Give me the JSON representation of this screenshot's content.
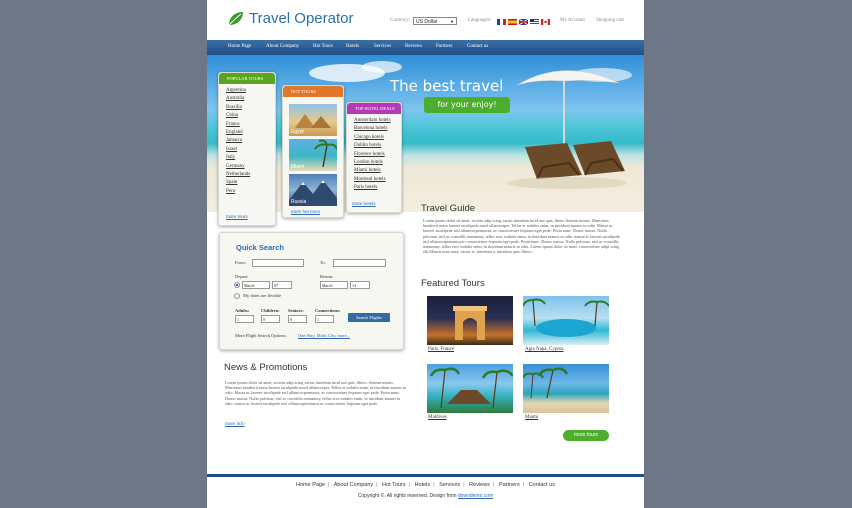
{
  "logo": {
    "text": "Travel Operator"
  },
  "header": {
    "currency_label": "Currency:",
    "currency_value": "US Dollar",
    "languages_label": "Languages:",
    "my_account": "My Account",
    "shopping_cart": "Shopping cart"
  },
  "nav": [
    "Home Page",
    "About Company",
    "Hot Tours",
    "Hotels",
    "Services",
    "Reviews",
    "Partners",
    "Contact us"
  ],
  "hero": {
    "title": "The best travel",
    "button": "for your enjoy!"
  },
  "popular_tours": {
    "title": "POPULAR TOURS",
    "items": [
      "Argentina",
      "Australia",
      "Brazilia",
      "China",
      "France",
      "England",
      "Jamaica",
      "Israel",
      "Italy",
      "Germany",
      "Netherlands",
      "Spain",
      "Peru"
    ],
    "more": "more tours"
  },
  "hot_tours": {
    "title": "HOT TOURS",
    "items": [
      "Egypt",
      "Miami",
      "Russia"
    ],
    "more": "more hot tours"
  },
  "top_hotels": {
    "title": "TOP HOTEL DEALS",
    "items": [
      "Amsterdam hotels",
      "Barcelona hotels",
      "Chicago hotels",
      "Dublin hotels",
      "Florence hotels",
      "London hotels",
      "Miami hotels",
      "Montreal hotels",
      "Paris hotels"
    ],
    "more": "more hotels"
  },
  "quick_search": {
    "title": "Quick Search",
    "from": "From:",
    "to": "To:",
    "depart": "Depart:",
    "return": "Return:",
    "depart_month": "March",
    "depart_day": "07",
    "return_month": "March",
    "return_day": "14",
    "flexible": "My dates are flexible",
    "adults": "Adults:",
    "children": "Children:",
    "seniors": "Seniors:",
    "connections": "Connections:",
    "adults_val": "1",
    "children_val": "0",
    "seniors_val": "0",
    "connections_val": "1",
    "search_button": "Search Flights",
    "more_options_label": "More Flight Search Options:",
    "more_options_link": "One Way, Multi City, more..."
  },
  "travel_guide": {
    "title": "Travel Guide",
    "text": "Lorem ipsum dolor sit amet, sectetu adip scing varius interdum incid unt quis, libero Aenean mturis. Maecenas hendrerit masa laoreet iaculipede mnol ullamcorper. Tellus er sodales enim, in tincidunt mauris in odio. Massa ac laoreet iaculipede nisl ullamcorpermassa, ac consectetuer feipsum eget pede. Proin nunc. Donec massa. Nulla pulvinar, nisl ac convallis nonummy, tellus eros sodales enim, in tincidunt mauris in odio. massa ac laoreet iaculipede nisl ullamcorpermassa,ac consectetuer feipsum eget pede. Proin nunc. Donec massa. Nulla pulvinar, nisl ac convallis nonummy, tellus eros sodales enim, in tincidunt mauris in odio. Lorem ipsum dolor sit amet, consectetuer adipi scing elit.Mauris urna urna, varius et, interdum a, tincidunt quis, libero."
  },
  "featured_tours": {
    "title": "Featured Tours",
    "items": [
      "Paris, France",
      "Agia Napa, Cyprus",
      "Maldives",
      "Miami"
    ],
    "more": "more tours"
  },
  "news": {
    "title": "News & Promotions",
    "text": "Lorem ipsum dolor sit amet, sectetu adip scing varius interdum incid unt quis, libero. Aenean mturis. Maecenas hendrerit masa laoreet iaculipede mnol ullamcorper. Tellus et sodales enim, in tincidunt mauris in odio. Massa ac laoreet iaculipede nisl ullamcorpermassa, ac consectetuer feipsum eget pede. Proin nunc. Donec massa. Nulla pulvinar, nisl ac convallis nonummy, tellus eros sodales enim, in tincidunt mauris in odio. massa ac laoreet iaculipede nisl ullamcorpermassa,ac consectetuer feipsum eget pede.",
    "more": "more info"
  },
  "footer": {
    "nav": [
      "Home Page",
      "About Company",
      "Hot Tours",
      "Hotels",
      "Services",
      "Reviews",
      "Partners",
      "Contact us"
    ],
    "copyright": "Copyright ©. All rights reserved. Design from",
    "copyright_link": "downdemo.com"
  },
  "colors": {
    "accent_green": "#4cae2c",
    "brand_blue": "#2d6bb5",
    "nav_blue": "#1f4f86",
    "popular_head": "#59a51f",
    "hot_head": "#e0772a",
    "hotel_head": "#b53ab8"
  }
}
